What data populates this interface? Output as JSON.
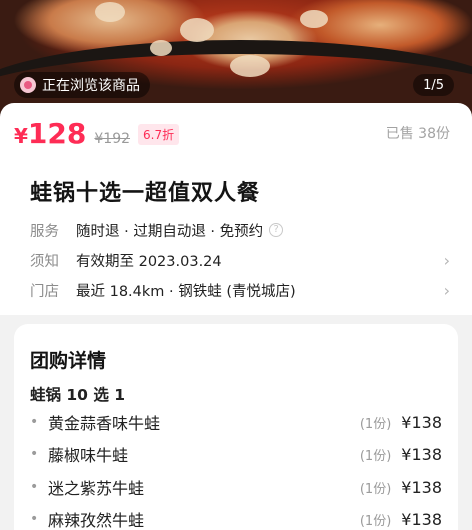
{
  "hero": {
    "browsing_text": "正在浏览该商品",
    "page_indicator": "1/5"
  },
  "price": {
    "currency": "¥",
    "current": "128",
    "original": "¥192",
    "discount": "6.7折",
    "sold": "已售 38份"
  },
  "title": "蛙锅十选一超值双人餐",
  "info": {
    "service_label": "服务",
    "service_value": "随时退 · 过期自动退 · 免预约",
    "notice_label": "须知",
    "notice_value": "有效期至 2023.03.24",
    "store_label": "门店",
    "store_value": "最近 18.4km · 钢铁蛙 (青悦城店)"
  },
  "group": {
    "title": "团购详情",
    "subtitle": "蛙锅 10 选 1",
    "items": [
      {
        "name": "黄金蒜香味牛蛙",
        "qty": "(1份)",
        "price": "¥138"
      },
      {
        "name": "藤椒味牛蛙",
        "qty": "(1份)",
        "price": "¥138"
      },
      {
        "name": "迷之紫苏牛蛙",
        "qty": "(1份)",
        "price": "¥138"
      },
      {
        "name": "麻辣孜然牛蛙",
        "qty": "(1份)",
        "price": "¥138"
      }
    ]
  },
  "colors": {
    "accent": "#fe2c55",
    "muted": "#9a9a9a"
  }
}
